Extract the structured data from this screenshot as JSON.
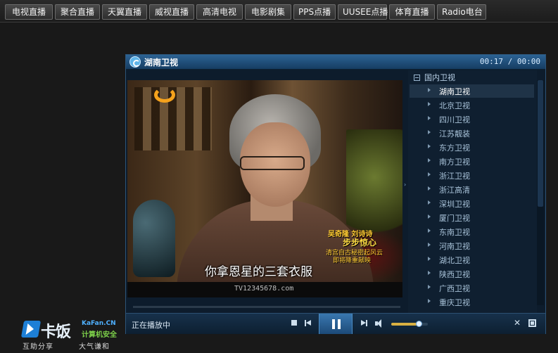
{
  "nav": {
    "tabs": [
      "电视直播",
      "聚合直播",
      "天翼直播",
      "威视直播",
      "高清电视",
      "电影剧集",
      "PPS点播",
      "UUSEE点播",
      "体育直播",
      "Radio电台"
    ]
  },
  "player": {
    "title": "湖南卫视",
    "time": "00:17 / 00:00",
    "status": "正在播放中",
    "volume_level": 0.75
  },
  "video": {
    "subtitle": "你拿恩星的三套衣服",
    "caption_name": "吴奇隆 刘诗诗",
    "caption_show": "步步惊心",
    "caption_line1": "清宫自古秘密起风云",
    "caption_line2": "即将降重献映",
    "watermark": "TV12345678.com"
  },
  "sidebar": {
    "group": "国内卫视",
    "channels": [
      "湖南卫视",
      "北京卫视",
      "四川卫视",
      "江苏靓装",
      "东方卫视",
      "南方卫视",
      "浙江卫视",
      "浙江高清",
      "深圳卫视",
      "厦门卫视",
      "东南卫视",
      "河南卫视",
      "湖北卫视",
      "陕西卫视",
      "广西卫视",
      "重庆卫视"
    ],
    "active_index": 0
  },
  "site_logo": {
    "name_cn": "卡饭",
    "name_en": "KaFan.CN",
    "sub": "计算机安全",
    "tagline1": "互助分享",
    "tagline2": "大气谦和"
  },
  "colors": {
    "accent": "#2c6394",
    "volume": "#d9b042"
  }
}
